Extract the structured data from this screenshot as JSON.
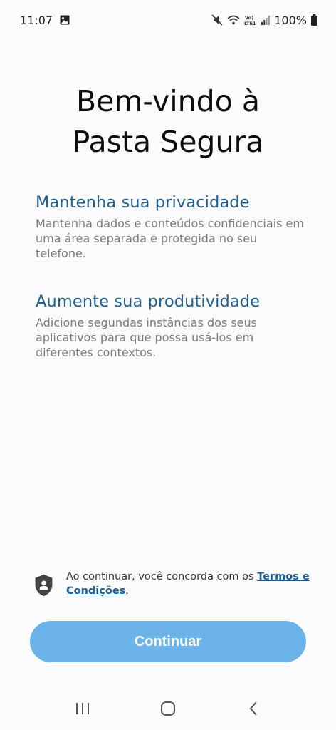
{
  "status_bar": {
    "time": "11:07",
    "battery": "100%",
    "icons": [
      "image-icon",
      "mute-icon",
      "wifi-icon",
      "volte-icon",
      "signal-icon",
      "battery-icon"
    ]
  },
  "welcome": {
    "title_line1": "Bem-vindo à",
    "title_line2": "Pasta Segura"
  },
  "features": [
    {
      "heading": "Mantenha sua privacidade",
      "description": "Mantenha dados e conteúdos confidenciais em uma área separada e protegida no seu telefone."
    },
    {
      "heading": "Aumente sua produtividade",
      "description": "Adicione segundas instâncias dos seus aplicativos para que possa usá-los em diferentes contextos."
    }
  ],
  "terms": {
    "prefix": "Ao continuar, você concorda com os ",
    "link": "Termos e Condições",
    "suffix": "."
  },
  "actions": {
    "continue_label": "Continuar"
  },
  "colors": {
    "accent": "#1f5e93",
    "button": "#6ab4ea",
    "background": "#fcfbfe"
  }
}
